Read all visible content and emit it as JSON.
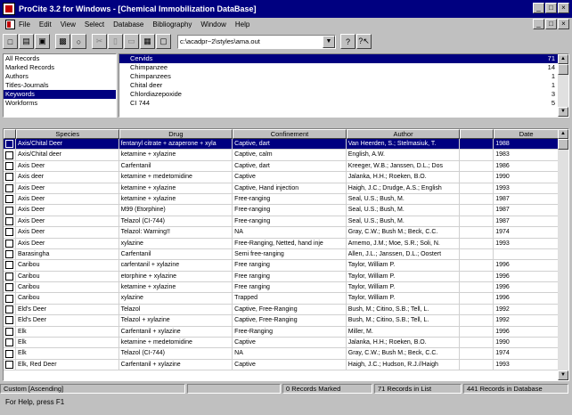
{
  "window": {
    "title": "ProCite 3.2 for Windows - [Chemical Immobilization DataBase]",
    "caption_buttons": [
      "_",
      "□",
      "×"
    ]
  },
  "menu": {
    "items": [
      "File",
      "Edit",
      "View",
      "Select",
      "Database",
      "Bibliography",
      "Window",
      "Help"
    ]
  },
  "toolbar": {
    "path": "c:\\acadpr~2\\styles\\ama.out",
    "help_label": "?",
    "context_help_label": "?↖"
  },
  "groups": {
    "items": [
      "All Records",
      "Marked Records",
      "Authors",
      "Titles-Journals",
      "Keywords",
      "Workforms"
    ],
    "selected_index": 4
  },
  "terms": {
    "items": [
      {
        "label": "Cervids",
        "count": "71"
      },
      {
        "label": "Chimpanzee",
        "count": "14"
      },
      {
        "label": "Chimpanzees",
        "count": "1"
      },
      {
        "label": "Chital deer",
        "count": "1"
      },
      {
        "label": "Chlordiazepoxide",
        "count": "3"
      },
      {
        "label": "CI 744",
        "count": "5"
      }
    ],
    "selected_index": 0
  },
  "table": {
    "headers": [
      "Species",
      "Drug",
      "Confinement",
      "Author",
      "Date"
    ],
    "selected_index": 0,
    "rows": [
      [
        "Axis/Chital Deer",
        "fentanyl citrate + azaperone + xyla",
        "Captive, dart",
        "Van Heerden, S.; Stelmasiuk, T.",
        "1988"
      ],
      [
        "Axis/Chital deer",
        "ketamine + xylazine",
        "Captive, calm",
        "English, A.W.",
        "1983"
      ],
      [
        "Axis Deer",
        "Carfentanil",
        "Captive, dart",
        "Kreeger, W.B.; Janssen, D.L.; Dos",
        "1986"
      ],
      [
        "Axis deer",
        "ketamine + medetomidine",
        "Captive",
        "Jalanka, H.H.; Roeken, B.O.",
        "1990"
      ],
      [
        "Axis Deer",
        "ketamine + xylazine",
        "Captive, Hand injection",
        "Haigh, J.C.; Drudge, A.S.; English",
        "1993"
      ],
      [
        "Axis Deer",
        "ketamine + xylazine",
        "Free-ranging",
        "Seal, U.S.; Bush, M.",
        "1987"
      ],
      [
        "Axis Deer",
        "M99 (Etorphine)",
        "Free-ranging",
        "Seal, U.S.; Bush, M.",
        "1987"
      ],
      [
        "Axis Deer",
        "Telazol (CI-744)",
        "Free-ranging",
        "Seal, U.S.; Bush, M.",
        "1987"
      ],
      [
        "Axis Deer",
        "Telazol: Warning!!",
        "NA",
        "Gray, C.W.; Bush M.; Beck, C.C.",
        "1974"
      ],
      [
        "Axis Deer",
        "xylazine",
        "Free-Ranging, Netted, hand inje",
        "Arnemo, J.M.; Moe, S.R.; Soli, N.",
        "1993"
      ],
      [
        "Barasingha",
        "Carfentanil",
        "Semi free-ranging",
        "Allen, J.L.; Janssen, D.L.; Oostert",
        ""
      ],
      [
        "Caribou",
        "carfentanil + xylazine",
        "Free ranging",
        "Taylor, William P.",
        "1996"
      ],
      [
        "Caribou",
        "etorphine + xylazine",
        "Free ranging",
        "Taylor, William P.",
        "1996"
      ],
      [
        "Caribou",
        "ketamine + xylazine",
        "Free ranging",
        "Taylor, William P.",
        "1996"
      ],
      [
        "Caribou",
        "xylazine",
        "Trapped",
        "Taylor, William P.",
        "1996"
      ],
      [
        "Eld's Deer",
        "Telazol",
        "Captive, Free-Ranging",
        "Bush, M.; Citino, S.B.; Tell, L.",
        "1992"
      ],
      [
        "Eld's Deer",
        "Telazol + xylazine",
        "Captive, Free-Ranging",
        "Bush, M.; Citino, S.B.; Tell, L.",
        "1992"
      ],
      [
        "Elk",
        "Carfentanil + xylazine",
        "Free-Ranging",
        "Miller, M.",
        "1996"
      ],
      [
        "Elk",
        "ketamine + medetomidine",
        "Captive",
        "Jalanka, H.H.; Roeken, B.O.",
        "1990"
      ],
      [
        "Elk",
        "Telazol (CI-744)",
        "NA",
        "Gray, C.W.; Bush M.; Beck, C.C.",
        "1974"
      ],
      [
        "Elk, Red Deer",
        "Carfentanil + xylazine",
        "Captive",
        "Haigh, J.C.; Hudson, R.J.//Haigh",
        "1993"
      ]
    ]
  },
  "status": {
    "sort": "Custom [Ascending]",
    "marked": "0 Records Marked",
    "in_list": "71 Records in List",
    "in_db": "441 Records in Database"
  },
  "help_text": "For Help, press F1"
}
